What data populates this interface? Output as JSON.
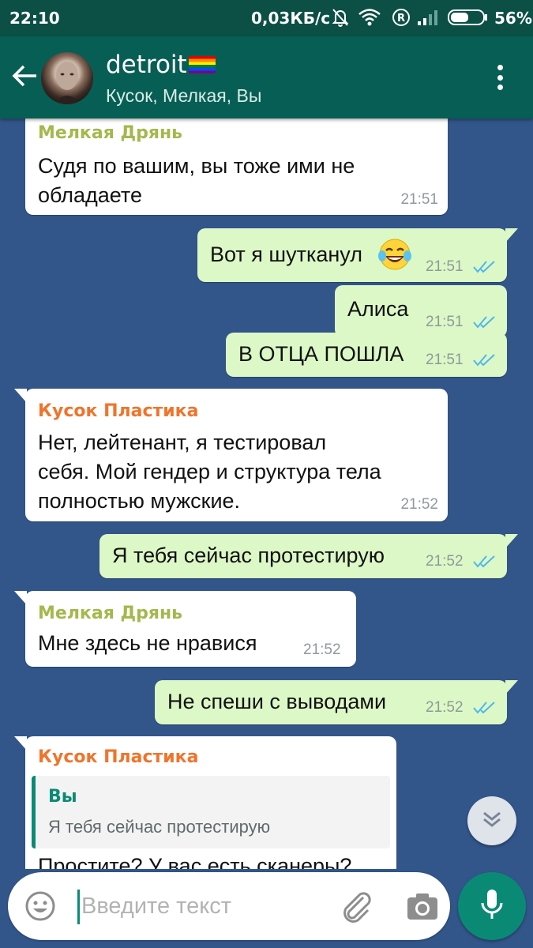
{
  "status_bar": {
    "time": "22:10",
    "network_speed": "0,03КБ/с",
    "battery_percent": "56%",
    "battery_level": 0.56,
    "icons": [
      "alarm-off-icon",
      "wifi-icon",
      "roaming-icon",
      "signal-icon",
      "battery-icon"
    ]
  },
  "header": {
    "title": "detroit",
    "title_emoji": "rainbow-flag",
    "members": "Кусок, Мелкая, Вы"
  },
  "messages": [
    {
      "direction": "in",
      "sender": "Мелкая Дрянь",
      "sender_color": "#a4b84c",
      "lines": [
        "Судя по вашим, вы тоже ими не",
        "обладаете"
      ],
      "time": "21:51"
    },
    {
      "direction": "out",
      "text": "Вот я шутканул",
      "emoji": "tears-of-joy",
      "time": "21:51",
      "read": true
    },
    {
      "direction": "out",
      "text": "Алиса",
      "time": "21:51",
      "read": true
    },
    {
      "direction": "out",
      "text": "В ОТЦА ПОШЛА",
      "time": "21:51",
      "read": true
    },
    {
      "direction": "in",
      "sender": "Кусок Пластика",
      "sender_color": "#f0742b",
      "lines": [
        "Нет, лейтенант, я тестировал",
        "себя. Мой гендер и структура тела",
        "полностью мужские."
      ],
      "time": "21:52"
    },
    {
      "direction": "out",
      "text": "Я тебя сейчас протестирую",
      "time": "21:52",
      "read": true
    },
    {
      "direction": "in",
      "sender": "Мелкая Дрянь",
      "sender_color": "#a4b84c",
      "lines": [
        "Мне здесь не нравися"
      ],
      "time": "21:52"
    },
    {
      "direction": "out",
      "text": "Не спеши с выводами",
      "time": "21:52",
      "read": true
    },
    {
      "direction": "in",
      "sender": "Кусок Пластика",
      "sender_color": "#f0742b",
      "quote": {
        "author": "Вы",
        "text": "Я тебя сейчас протестирую"
      },
      "lines": [
        "Простите? У вас есть сканеры?"
      ]
    }
  ],
  "composer": {
    "placeholder": "Введите текст",
    "value": ""
  },
  "colors": {
    "chat_background": "#32558a",
    "header": "#075e54",
    "status_bar": "#0b4f45",
    "outgoing_bubble": "#dcf8c6",
    "incoming_bubble": "#ffffff",
    "read_ticks": "#4fb6ec",
    "accent": "#0a8a75"
  }
}
